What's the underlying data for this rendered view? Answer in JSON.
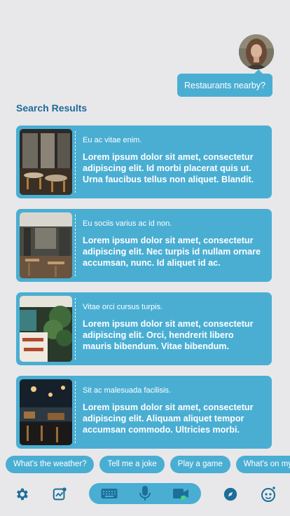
{
  "chat": {
    "user_message": "Restaurants nearby?"
  },
  "results": {
    "title": "Search Results",
    "items": [
      {
        "subtitle": "Eu ac vitae enim.",
        "body": "Lorem ipsum dolor sit amet, consectetur adipiscing elit. Id morbi placerat quis ut. Urna faucibus tellus non aliquet. Blandit."
      },
      {
        "subtitle": "Eu sociis varius ac id non.",
        "body": "Lorem ipsum dolor sit amet, consectetur adipiscing elit. Nec turpis id nullam ornare accumsan, nunc. Id aliquet id ac."
      },
      {
        "subtitle": "Vitae orci cursus turpis.",
        "body": "Lorem ipsum dolor sit amet, consectetur adipiscing elit. Orci, hendrerit libero mauris bibendum. Vitae bibendum."
      },
      {
        "subtitle": "Sit ac malesuada facilisis.",
        "body": "Lorem ipsum dolor sit amet, consectetur adipiscing elit. Aliquam aliquet tempor accumsan commodo. Ultricies morbi."
      }
    ]
  },
  "suggestions": [
    "What's the weather?",
    "Tell me a joke",
    "Play a game",
    "What's on my"
  ],
  "bottom_bar": {
    "icons": [
      "gear-icon",
      "chart-icon",
      "keyboard-icon",
      "microphone-icon",
      "video-icon",
      "compass-icon",
      "bot-face-icon"
    ]
  },
  "colors": {
    "background": "#e8e8ea",
    "accent": "#4aaed3",
    "title": "#1f6a99",
    "icon": "#1d6f99"
  }
}
